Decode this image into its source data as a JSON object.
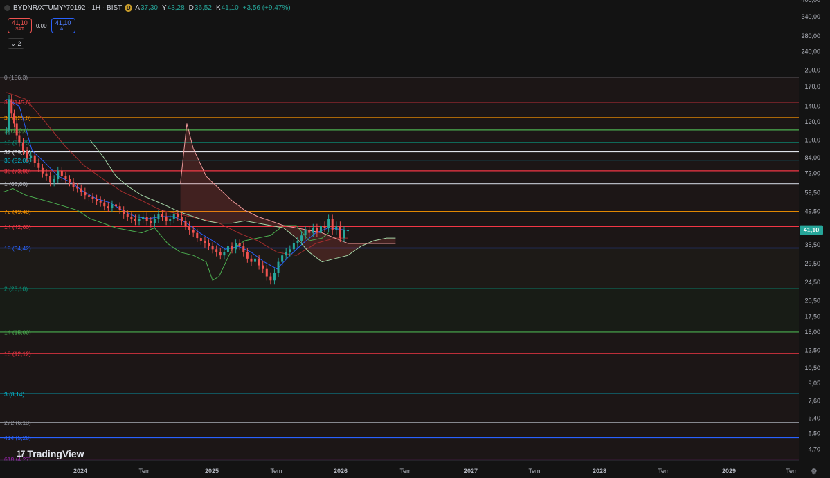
{
  "header": {
    "symbol": "BYDNR/XTUMY*70192 · 1H · BIST",
    "badge": "D",
    "ohlc": [
      {
        "k": "A",
        "v": "37,30"
      },
      {
        "k": "Y",
        "v": "43,28"
      },
      {
        "k": "D",
        "v": "36,52"
      },
      {
        "k": "K",
        "v": "41,10"
      }
    ],
    "change": "+3,56 (+9,47%)"
  },
  "trade": {
    "sell_price": "41,10",
    "sell_label": "SAT",
    "spread": "0,00",
    "buy_price": "41,10",
    "buy_label": "AL"
  },
  "collapse_label": "2",
  "brand": "TradingView",
  "colors": {
    "background": "#131313",
    "up": "#26a69a",
    "down": "#ef5350",
    "price_tag": "#26a69a",
    "conversion": "#2962ff",
    "base": "#a32d2d",
    "lagging": "#4caf50",
    "spanA": "#a5d6a7",
    "spanB": "#ef9a9a"
  },
  "chart_data": {
    "type": "line",
    "scale": "log",
    "y_axis_side": "right",
    "ylim": [
      4.2,
      400
    ],
    "y_ticks": [
      {
        "v": 400,
        "label": "400,00"
      },
      {
        "v": 340,
        "label": "340,00"
      },
      {
        "v": 280,
        "label": "280,00"
      },
      {
        "v": 240,
        "label": "240,00"
      },
      {
        "v": 200,
        "label": "200,0"
      },
      {
        "v": 170,
        "label": "170,0"
      },
      {
        "v": 140,
        "label": "140,0"
      },
      {
        "v": 120,
        "label": "120,0"
      },
      {
        "v": 100,
        "label": "100,0"
      },
      {
        "v": 84,
        "label": "84,00"
      },
      {
        "v": 72,
        "label": "72,00"
      },
      {
        "v": 59.5,
        "label": "59,50"
      },
      {
        "v": 49.5,
        "label": "49,50"
      },
      {
        "v": 35.5,
        "label": "35,50"
      },
      {
        "v": 29.5,
        "label": "29,50"
      },
      {
        "v": 24.5,
        "label": "24,50"
      },
      {
        "v": 20.5,
        "label": "20,50"
      },
      {
        "v": 17.5,
        "label": "17,50"
      },
      {
        "v": 15.0,
        "label": "15,00"
      },
      {
        "v": 12.5,
        "label": "12,50"
      },
      {
        "v": 10.5,
        "label": "10,50"
      },
      {
        "v": 9.05,
        "label": "9,05"
      },
      {
        "v": 7.6,
        "label": "7,60"
      },
      {
        "v": 6.4,
        "label": "6,40"
      },
      {
        "v": 5.5,
        "label": "5,50"
      },
      {
        "v": 4.7,
        "label": "4,70"
      }
    ],
    "last_price": {
      "v": 41.1,
      "label": "41,10"
    },
    "x_axis": [
      "2024",
      "Tem",
      "2025",
      "Tem",
      "2026",
      "Tem",
      "2027",
      "Tem",
      "2028",
      "Tem",
      "2029",
      "Tem"
    ],
    "x_range": [
      2023.65,
      2029.85
    ],
    "fib_levels": [
      {
        "v": 186.3,
        "label": "0 (186,3)",
        "color": "#9598a1"
      },
      {
        "v": 145.6,
        "label": "36 (145,6)",
        "color": "#f23645"
      },
      {
        "v": 125.0,
        "label": "32 (125,0)",
        "color": "#ff9800"
      },
      {
        "v": 110.6,
        "label": ",5 (110,6)",
        "color": "#4caf50"
      },
      {
        "v": 97.75,
        "label": "18 (97,75)",
        "color": "#089981"
      },
      {
        "v": 89.1,
        "label": "37 (89,10)",
        "color": "#e0e3eb"
      },
      {
        "v": 82.05,
        "label": "36 (82,05)",
        "color": "#00bcd4"
      },
      {
        "v": 73.9,
        "label": "36 (73,90)",
        "color": "#f23645"
      },
      {
        "v": 65.0,
        "label": "1 (65,00)",
        "color": "#b2b5be"
      },
      {
        "v": 49.4,
        "label": "72 (49,40)",
        "color": "#ff9800"
      },
      {
        "v": 42.6,
        "label": "14 (42,60)",
        "color": "#f23645"
      },
      {
        "v": 34.42,
        "label": "18 (34,42)",
        "color": "#2962ff"
      },
      {
        "v": 23.1,
        "label": "2 (23,10)",
        "color": "#089981"
      },
      {
        "v": 15.0,
        "label": "14 (15,00)",
        "color": "#4caf50"
      },
      {
        "v": 12.12,
        "label": "18 (12,12)",
        "color": "#f23645"
      },
      {
        "v": 8.14,
        "label": "3 (8,14)",
        "color": "#00bcd4"
      },
      {
        "v": 6.13,
        "label": "272 (6,13)",
        "color": "#9598a1"
      },
      {
        "v": 5.28,
        "label": "414 (5,28)",
        "color": "#2962ff"
      },
      {
        "v": 4.27,
        "label": "618 (4,27)",
        "color": "#9c27b0"
      }
    ],
    "price": {
      "x": [
        2023.7,
        2023.72,
        2023.74,
        2023.76,
        2023.78,
        2023.8,
        2023.83,
        2023.86,
        2023.89,
        2023.92,
        2023.95,
        2023.98,
        2024.01,
        2024.04,
        2024.07,
        2024.1,
        2024.13,
        2024.16,
        2024.19,
        2024.22,
        2024.25,
        2024.28,
        2024.31,
        2024.34,
        2024.37,
        2024.4,
        2024.43,
        2024.46,
        2024.49,
        2024.52,
        2024.55,
        2024.58,
        2024.61,
        2024.64,
        2024.67,
        2024.7,
        2024.73,
        2024.76,
        2024.79,
        2024.82,
        2024.85,
        2024.88,
        2024.91,
        2024.94,
        2024.97,
        2025.0,
        2025.03,
        2025.06,
        2025.09,
        2025.12,
        2025.15,
        2025.18,
        2025.21,
        2025.24,
        2025.27,
        2025.3,
        2025.33,
        2025.36,
        2025.39,
        2025.42,
        2025.45,
        2025.48,
        2025.51,
        2025.54,
        2025.57,
        2025.6,
        2025.63,
        2025.66,
        2025.69,
        2025.72,
        2025.75,
        2025.78,
        2025.81,
        2025.84,
        2025.87,
        2025.9,
        2025.93,
        2025.96,
        2025.99,
        2026.02,
        2026.05,
        2026.08,
        2026.11,
        2026.14,
        2026.17,
        2026.2,
        2026.23,
        2026.26,
        2026.29,
        2026.32,
        2026.35
      ],
      "y": [
        110,
        150,
        130,
        118,
        105,
        98,
        90,
        84,
        86,
        80,
        76,
        72,
        70,
        66,
        68,
        74,
        70,
        68,
        66,
        63,
        62,
        60,
        58,
        57,
        56,
        55,
        54,
        52,
        51,
        53,
        52,
        50,
        48,
        47,
        46,
        45,
        46,
        47,
        45,
        44,
        46,
        48,
        47,
        45,
        46,
        48,
        47,
        45,
        43,
        41,
        40,
        38,
        37,
        36,
        35,
        34,
        33,
        32,
        33,
        35,
        34,
        36,
        35,
        33,
        31,
        30,
        31,
        29,
        28,
        26,
        25,
        27,
        30,
        32,
        33,
        34,
        36,
        37,
        39,
        41,
        40,
        42,
        40,
        43,
        42,
        46,
        41,
        43,
        38,
        41,
        41.1
      ]
    },
    "series": [
      {
        "name": "",
        "key": "conversion",
        "color": "#2962ff",
        "x": [
          2023.7,
          2023.8,
          2023.9,
          2024.0,
          2024.1,
          2024.2,
          2024.3,
          2024.4,
          2024.5,
          2024.6,
          2024.7,
          2024.8,
          2024.9,
          2025.0,
          2025.1,
          2025.2,
          2025.3,
          2025.4,
          2025.5,
          2025.6,
          2025.7,
          2025.8,
          2025.9,
          2026.0,
          2026.1,
          2026.2,
          2026.35
        ],
        "y": [
          150,
          140,
          90,
          80,
          70,
          66,
          60,
          56,
          54,
          50,
          47,
          46,
          47,
          47,
          44,
          40,
          37,
          34,
          35,
          33,
          30,
          28,
          32,
          36,
          40,
          42,
          41
        ]
      },
      {
        "name": "",
        "key": "base",
        "color": "#a32d2d",
        "x": [
          2023.7,
          2023.85,
          2024.0,
          2024.15,
          2024.3,
          2024.45,
          2024.6,
          2024.75,
          2024.9,
          2025.05,
          2025.2,
          2025.35,
          2025.5,
          2025.65,
          2025.8,
          2025.95,
          2026.1,
          2026.25,
          2026.35
        ],
        "y": [
          160,
          150,
          120,
          95,
          78,
          68,
          60,
          55,
          50,
          48,
          46,
          44,
          40,
          37,
          33,
          32,
          36,
          38,
          38
        ]
      },
      {
        "name": "",
        "key": "lagging",
        "color": "#4caf50",
        "x": [
          2023.68,
          2023.75,
          2023.85,
          2023.95,
          2024.05,
          2024.15,
          2024.25,
          2024.35,
          2024.45,
          2024.55,
          2024.65,
          2024.75,
          2024.85,
          2024.95,
          2025.05,
          2025.15,
          2025.25,
          2025.3,
          2025.35,
          2025.45,
          2025.55,
          2025.65,
          2025.75,
          2025.85,
          2025.95,
          2026.05,
          2026.15,
          2026.2
        ],
        "y": [
          60,
          62,
          58,
          56,
          54,
          52,
          50,
          46,
          44,
          42,
          41,
          40,
          42,
          36,
          33,
          32,
          30,
          25,
          26,
          34,
          37,
          38,
          39,
          43,
          43,
          37,
          38,
          40
        ]
      },
      {
        "name": "",
        "key": "spanA",
        "color": "#a5d6a7",
        "x": [
          2024.35,
          2024.45,
          2024.55,
          2024.65,
          2024.75,
          2024.85,
          2024.95,
          2025.05,
          2025.15,
          2025.25,
          2025.35,
          2025.45,
          2025.55,
          2025.65,
          2025.75,
          2025.85,
          2025.95,
          2026.05,
          2026.15,
          2026.25,
          2026.35,
          2026.45,
          2026.55,
          2026.65,
          2026.72
        ],
        "y": [
          100,
          85,
          70,
          63,
          58,
          55,
          52,
          49,
          47,
          45,
          44,
          44,
          45,
          44,
          43,
          42,
          38,
          33,
          30,
          31,
          32,
          35,
          37,
          38,
          38
        ]
      },
      {
        "name": "",
        "key": "spanB",
        "color": "#ef9a9a",
        "x": [
          2025.05,
          2025.1,
          2025.15,
          2025.25,
          2025.35,
          2025.45,
          2025.55,
          2025.65,
          2025.75,
          2025.85,
          2025.95,
          2026.05,
          2026.15,
          2026.25,
          2026.35,
          2026.45,
          2026.55,
          2026.65,
          2026.72
        ],
        "y": [
          65,
          118,
          92,
          70,
          62,
          55,
          50,
          47,
          45,
          43,
          42,
          41,
          40,
          38,
          36,
          36,
          36,
          36,
          36
        ]
      }
    ]
  }
}
